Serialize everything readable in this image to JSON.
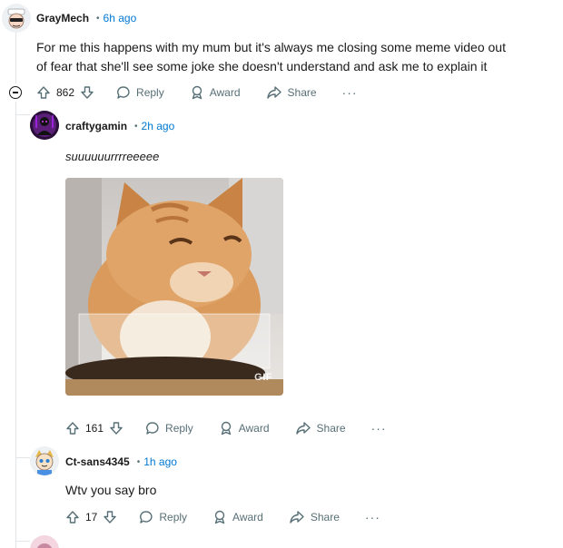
{
  "comments": [
    {
      "username": "GrayMech",
      "time": "6h ago",
      "body": "For me this happens with my mum but it's always me closing some meme video out of fear that she'll see some joke she doesn't understand and ask me to explain it",
      "votes": "862",
      "reply_label": "Reply",
      "award_label": "Award",
      "share_label": "Share",
      "more_label": "···"
    },
    {
      "username": "craftygamin",
      "time": "2h ago",
      "body": "suuuuuurrrreeeee",
      "gif_label": "GIF",
      "votes": "161",
      "reply_label": "Reply",
      "award_label": "Award",
      "share_label": "Share",
      "more_label": "···"
    },
    {
      "username": "Ct-sans4345",
      "time": "1h ago",
      "body": "Wtv you say bro",
      "votes": "17",
      "reply_label": "Reply",
      "award_label": "Award",
      "share_label": "Share",
      "more_label": "···"
    }
  ],
  "colors": {
    "time_blue": "#0079d3",
    "muted": "#576f76",
    "thread_line": "#e3e6e8"
  },
  "icons": [
    "collapse-icon",
    "upvote-icon",
    "downvote-icon",
    "reply-icon",
    "award-icon",
    "share-icon",
    "more-icon"
  ]
}
